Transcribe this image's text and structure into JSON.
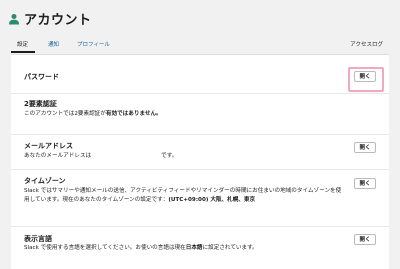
{
  "header": {
    "title": "アカウント",
    "icon": "person-icon",
    "icon_color": "#2c8a6e"
  },
  "tabs": {
    "settings": "設定",
    "notifications": "通知",
    "profile": "プロフィール",
    "access_logs": "アクセスログ"
  },
  "rows": {
    "password": {
      "title": "パスワード",
      "button": "開く"
    },
    "two_factor": {
      "title": "2要素認証",
      "desc_prefix": "このアカウントでは2要素認証が",
      "desc_bold": "有効ではありません。"
    },
    "email": {
      "title": "メールアドレス",
      "desc_prefix": "あなたのメールアドレスは",
      "desc_suffix": "です。",
      "button": "開く"
    },
    "timezone": {
      "title": "タイムゾーン",
      "desc": "Slack ではサマリーや通知メールの送信、アクティビティフィードやリマインダーの時間にお住まいの地域のタイムゾーンを使用しています。現在のあなたのタイムゾーンの設定です：",
      "desc_bold": "(UTC+09:00) 大阪、札幌、東京",
      "button": "開く"
    },
    "language": {
      "title": "表示言語",
      "desc_prefix": "Slack で使用する言語を選択してください。お使いの言語は現在",
      "desc_bold": "日本語",
      "desc_suffix": "に設定されています。",
      "button": "開く"
    }
  },
  "highlight_color": "#f2a7c3"
}
